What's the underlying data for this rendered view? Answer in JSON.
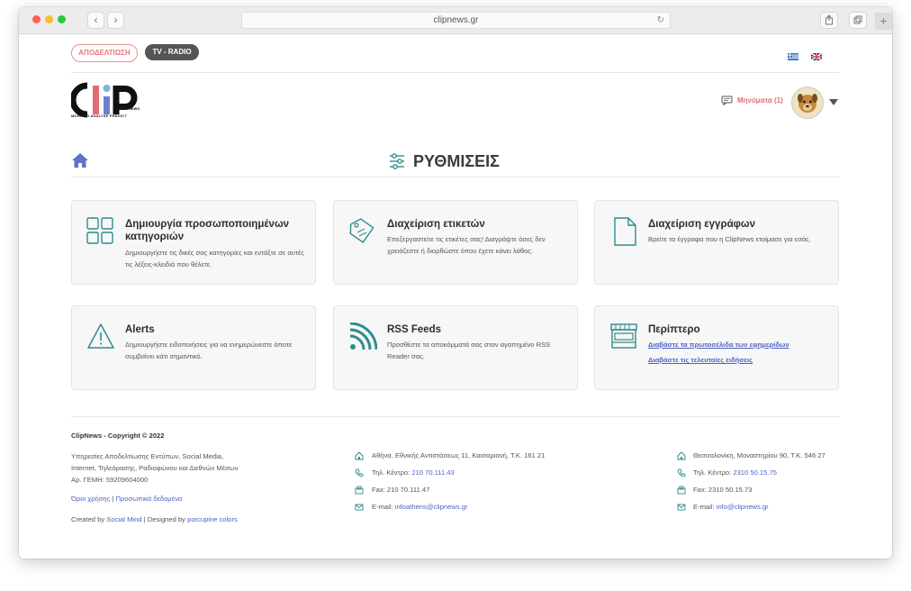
{
  "browser": {
    "url": "clipnews.gr"
  },
  "top": {
    "pill_clippings": "ΑΠΟΔΕΛΤΙΩΣΗ",
    "pill_tvradio": "TV - RADIO"
  },
  "header": {
    "logo_tagline": "MONITOR ANALYSE PREDICT",
    "messages_label": "Μηνύματα (1)"
  },
  "page": {
    "title": "ΡΥΘΜΙΣΕΙΣ"
  },
  "cards": [
    {
      "title": "Δημιουργία προσωποποιημένων κατηγοριών",
      "desc": "Δημιουργήστε τις δικές σας κατηγορίες και εντάξτε σε αυτές τις λέξεις-κλειδιά που θέλετε.",
      "icon": "grid-icon"
    },
    {
      "title": "Διαχείριση ετικετών",
      "desc": "Επεξεργαστείτε τις ετικέτες σας! Διαγράψτε όσες δεν χρειάζεστε ή διορθώστε όπου έχετε κάνει λάθος.",
      "icon": "tag-icon"
    },
    {
      "title": "Διαχείριση εγγράφων",
      "desc": "Βρείτε τα έγγραφα που η ClipNews ετοίμασε για εσάς.",
      "icon": "document-icon"
    },
    {
      "title": "Alerts",
      "desc": "Δημιουργήστε ειδοποιήσεις για να ενημερώνεστε όποτε συμβαίνει κάτι σημαντικό.",
      "icon": "warning-icon"
    },
    {
      "title": "RSS Feeds",
      "desc": "Προσθέστε τα αποκόμματά σας στον αγαπημένο RSS Reader σας.",
      "icon": "rss-icon"
    },
    {
      "title": "Περίπτερο",
      "link1": "Διαβάστε τα πρωτοσέλιδα των εφημερίδων",
      "link2": "Διαβάστε τις τελευταίες ειδήσεις",
      "icon": "kiosk-icon"
    }
  ],
  "footer": {
    "copyright": "ClipNews - Copyright © 2022",
    "about_line1": "Υπηρεσίες Αποδελτίωσης Εντύπων, Social Media,",
    "about_line2": "Internet, Τηλεόρασης, Ραδιοφώνου και Διεθνών Μέσων",
    "about_line3": "Αρ. ΓΕΜΗ: 59209604000",
    "terms": "Όροι χρήσης",
    "sep": "|",
    "privacy": "Προσωπικά δεδομένα",
    "created_prefix": "Created by",
    "created_by": "Social Mind",
    "designed_prefix": "| Designed by",
    "designed_by": "porcupine colors",
    "athens": {
      "address": "Αθήνα, Εθνικής Αντιστάσεως 11, Καισαριανή, Τ.Κ. 161 21",
      "phone_label": "Τηλ. Κέντρο:",
      "phone": "210 70.111.43",
      "fax": "Fax: 210 70.111.47",
      "email_label": "E-mail:",
      "email": "infoathens@clipnews.gr"
    },
    "thessaloniki": {
      "address": "Θεσσαλονίκη, Μοναστηρίου 90, Τ.Κ. 546 27",
      "phone_label": "Τηλ. Κέντρο:",
      "phone": "2310 50.15.75",
      "fax": "Fax: 2310 50.15.73",
      "email_label": "E-mail:",
      "email": "info@clipnews.gr"
    }
  },
  "colors": {
    "teal": "#2f8c8c",
    "accent_red": "#e16e70",
    "link_blue": "#4f62c4",
    "home_blue": "#5d72c9"
  }
}
